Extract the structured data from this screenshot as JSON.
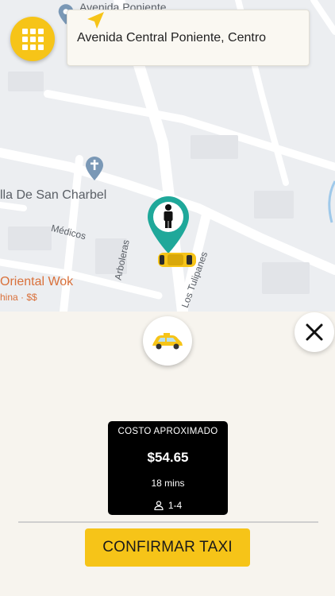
{
  "map": {
    "labels": {
      "street_top": "Avenida Poniente",
      "church": "lla De San Charbel",
      "medicos": "Médicos",
      "restaurant": "Oriental Wok",
      "restaurant_sub": "hina · $$",
      "arboleras": "Arboleras",
      "tulipanes": "Los Tulipanes"
    },
    "icons": {
      "menu": "grid-menu-icon",
      "pin": "person-pin-icon",
      "taxi": "taxi-car-icon",
      "church": "church-cross-icon"
    }
  },
  "address": {
    "text": "Avenida Central Poniente, Centro",
    "icon": "navigation-arrow-icon"
  },
  "sheet": {
    "close_icon": "close-icon",
    "cost_card": {
      "title": "COSTO APROXIMADO",
      "price": "$54.65",
      "duration": "18 mins",
      "passengers": "1-4",
      "passengers_icon": "person-icon"
    },
    "confirm_label": "CONFIRMAR TAXI"
  },
  "colors": {
    "accent": "#f6c418",
    "pin": "#1fa89a",
    "card": "#000000"
  }
}
